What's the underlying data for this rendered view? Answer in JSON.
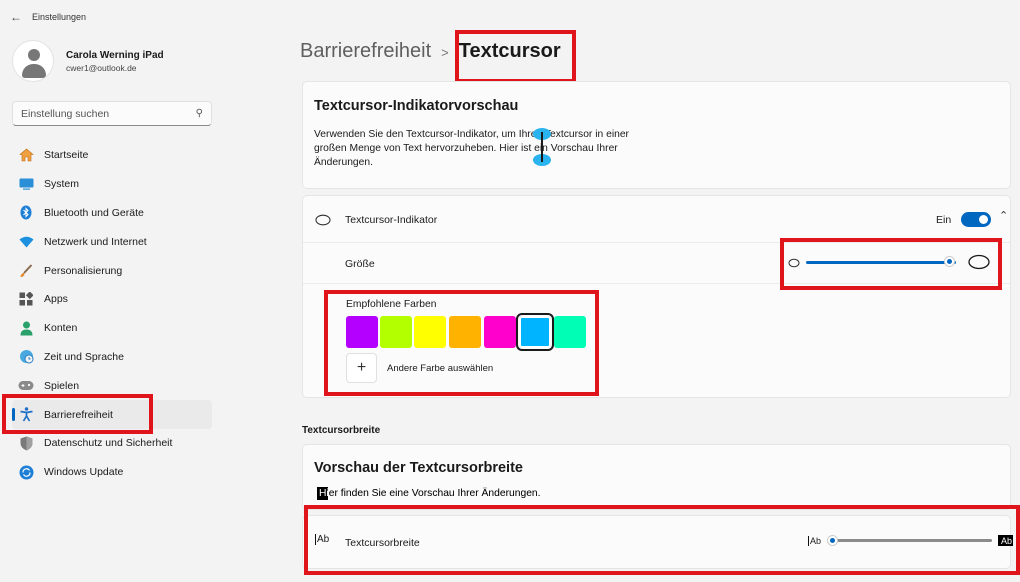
{
  "window": {
    "title": "Einstellungen"
  },
  "profile": {
    "name": "Carola Werning iPad",
    "email": "cwer1@outlook.de"
  },
  "search": {
    "placeholder": "Einstellung suchen"
  },
  "sidebar": {
    "items": [
      {
        "label": "Startseite",
        "icon": "home-icon"
      },
      {
        "label": "System",
        "icon": "system-icon"
      },
      {
        "label": "Bluetooth und Geräte",
        "icon": "bluetooth-icon"
      },
      {
        "label": "Netzwerk und Internet",
        "icon": "wifi-icon"
      },
      {
        "label": "Personalisierung",
        "icon": "brush-icon"
      },
      {
        "label": "Apps",
        "icon": "apps-icon"
      },
      {
        "label": "Konten",
        "icon": "person-icon"
      },
      {
        "label": "Zeit und Sprache",
        "icon": "clock-globe-icon"
      },
      {
        "label": "Spielen",
        "icon": "gamepad-icon"
      },
      {
        "label": "Barrierefreiheit",
        "icon": "accessibility-icon",
        "active": true
      },
      {
        "label": "Datenschutz und Sicherheit",
        "icon": "shield-icon"
      },
      {
        "label": "Windows Update",
        "icon": "update-icon"
      }
    ]
  },
  "breadcrumb": {
    "parent": "Barrierefreiheit",
    "separator": ">",
    "current": "Textcursor"
  },
  "preview": {
    "title": "Textcursor-Indikatorvorschau",
    "text": "Verwenden Sie den Textcursor-Indikator, um Ihren Textcursor in einer großen Menge von Text hervorzuheben. Hier ist ein Vorschau Ihrer Änderungen."
  },
  "indicator": {
    "label": "Textcursor-Indikator",
    "state": "Ein"
  },
  "size": {
    "label": "Größe",
    "value_fraction": 0.95
  },
  "colors": {
    "label": "Empfohlene Farben",
    "swatches": [
      "#b300ff",
      "#b3ff00",
      "#ffff00",
      "#ffb300",
      "#ff00cc",
      "#00b4ff",
      "#00ffb4"
    ],
    "selected_index": 5,
    "custom_label": "Andere Farbe auswählen"
  },
  "width_section": {
    "heading": "Textcursorbreite",
    "preview_title": "Vorschau der Textcursorbreite",
    "preview_text": "Hier finden Sie eine Vorschau Ihrer Änderungen.",
    "row_label": "Textcursorbreite",
    "row_icon_text": "Ab",
    "slider_min_icon_text": "Ab",
    "slider_max_icon_text": "Ab",
    "value_fraction": 0
  },
  "accent": "#0067c0",
  "highlight_color": "#e0141b"
}
